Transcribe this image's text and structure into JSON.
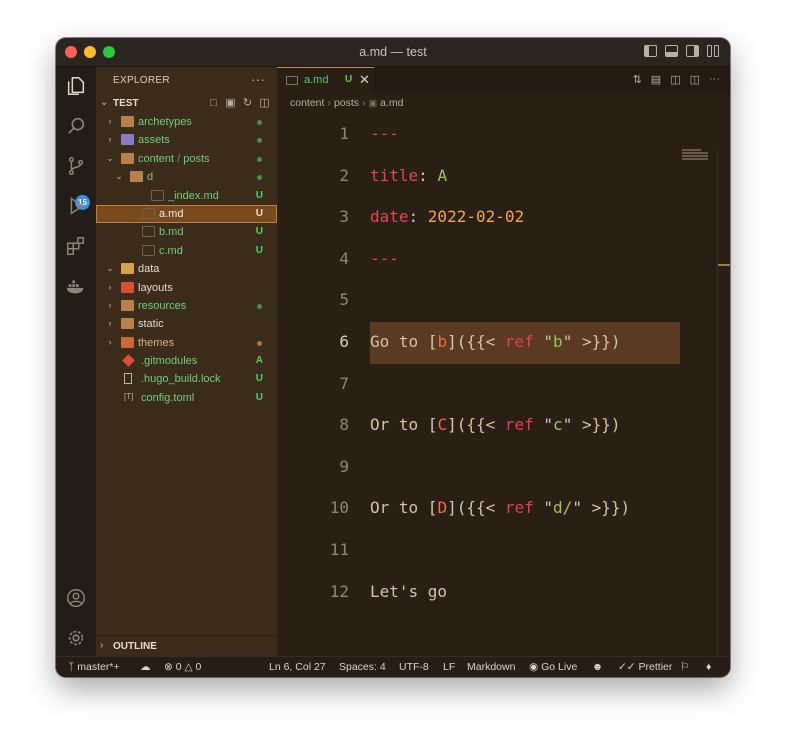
{
  "window": {
    "title": "a.md — test"
  },
  "activity": {
    "scm_badge": "15"
  },
  "sidebar": {
    "header": "EXPLORER",
    "more": "···",
    "folder": "TEST",
    "outline": "OUTLINE",
    "items": [
      {
        "label": "archetypes",
        "status": "",
        "color": "#6fcf7c",
        "type": "folder",
        "open": false,
        "indent": 0,
        "dot": "#4e8a52"
      },
      {
        "label": "assets",
        "status": "",
        "color": "#6fcf7c",
        "type": "folder-assets",
        "open": false,
        "indent": 0,
        "dot": "#4e8a52"
      },
      {
        "label": "content",
        "label2": "posts",
        "status": "",
        "color": "#6fcf7c",
        "type": "folder",
        "open": true,
        "indent": 0,
        "dot": "#4e8a52"
      },
      {
        "label": "d",
        "status": "",
        "color": "#6fcf7c",
        "type": "folder",
        "open": true,
        "indent": 1,
        "dot": "#4e8a52"
      },
      {
        "label": "_index.md",
        "status": "U",
        "color": "#6fcf7c",
        "type": "md",
        "indent": 3
      },
      {
        "label": "a.md",
        "status": "U",
        "color": "#f1ece4",
        "type": "md",
        "indent": 2,
        "selected": true
      },
      {
        "label": "b.md",
        "status": "U",
        "color": "#6fcf7c",
        "type": "md",
        "indent": 2
      },
      {
        "label": "c.md",
        "status": "U",
        "color": "#6fcf7c",
        "type": "md",
        "indent": 2
      },
      {
        "label": "data",
        "status": "",
        "color": "#e3dbcf",
        "type": "folder-data",
        "open": true,
        "indent": 0
      },
      {
        "label": "layouts",
        "status": "",
        "color": "#e3dbcf",
        "type": "folder-layouts",
        "open": false,
        "indent": 0
      },
      {
        "label": "resources",
        "status": "",
        "color": "#6fcf7c",
        "type": "folder",
        "open": false,
        "indent": 0,
        "dot": "#4e8a52"
      },
      {
        "label": "static",
        "status": "",
        "color": "#e3dbcf",
        "type": "folder",
        "open": false,
        "indent": 0
      },
      {
        "label": "themes",
        "status": "",
        "color": "#d6b67a",
        "type": "folder-themes",
        "open": false,
        "indent": 0,
        "dot": "#9a7d4d"
      },
      {
        "label": ".gitmodules",
        "status": "A",
        "color": "#6fcf7c",
        "type": "git",
        "indent": 0
      },
      {
        "label": ".hugo_build.lock",
        "status": "U",
        "color": "#6fcf7c",
        "type": "file",
        "indent": 0
      },
      {
        "label": "config.toml",
        "status": "U",
        "color": "#6fcf7c",
        "type": "toml",
        "indent": 0
      }
    ]
  },
  "editor": {
    "tab": {
      "name": "a.md",
      "status": "U",
      "close": "✕"
    },
    "breadcrumb": [
      "content",
      "posts",
      "a.md"
    ],
    "lines": [
      {
        "n": "1",
        "parts": [
          [
            "---",
            "c-dash"
          ]
        ]
      },
      {
        "n": "2",
        "parts": [
          [
            "title",
            "c-key"
          ],
          [
            ": ",
            "c-punc"
          ],
          [
            "A",
            "c-a"
          ]
        ]
      },
      {
        "n": "3",
        "parts": [
          [
            "date",
            "c-key"
          ],
          [
            ": ",
            "c-punc"
          ],
          [
            "2022-02-02",
            "c-date"
          ]
        ]
      },
      {
        "n": "4",
        "parts": [
          [
            "---",
            "c-dash"
          ]
        ]
      },
      {
        "n": "5",
        "parts": []
      },
      {
        "n": "6",
        "current": true,
        "parts": [
          [
            "Go to ",
            "c-text"
          ],
          [
            "[",
            "c-punc"
          ],
          [
            "b",
            "c-link"
          ],
          [
            "](",
            "c-punc"
          ],
          [
            "{{< ",
            "c-text"
          ],
          [
            "ref",
            "c-ref"
          ],
          [
            " \"",
            "c-text"
          ],
          [
            "b",
            "c-str"
          ],
          [
            "\" >}})",
            "c-text"
          ]
        ]
      },
      {
        "n": "7",
        "parts": []
      },
      {
        "n": "8",
        "parts": [
          [
            "Or to ",
            "c-text"
          ],
          [
            "[",
            "c-punc"
          ],
          [
            "C",
            "c-link"
          ],
          [
            "](",
            "c-punc"
          ],
          [
            "{{< ",
            "c-text"
          ],
          [
            "ref",
            "c-ref"
          ],
          [
            " \"",
            "c-text"
          ],
          [
            "c",
            "c-str"
          ],
          [
            "\" >}})",
            "c-text"
          ]
        ]
      },
      {
        "n": "9",
        "parts": []
      },
      {
        "n": "10",
        "parts": [
          [
            "Or to ",
            "c-text"
          ],
          [
            "[",
            "c-punc"
          ],
          [
            "D",
            "c-link"
          ],
          [
            "](",
            "c-punc"
          ],
          [
            "{{< ",
            "c-text"
          ],
          [
            "ref",
            "c-ref"
          ],
          [
            " \"",
            "c-text"
          ],
          [
            "d/",
            "c-str"
          ],
          [
            "\" >}})",
            "c-text"
          ]
        ]
      },
      {
        "n": "11",
        "parts": []
      },
      {
        "n": "12",
        "parts": [
          [
            "Let's go",
            "c-text"
          ]
        ]
      }
    ]
  },
  "status": {
    "branch": "master*+",
    "errors": "0",
    "warnings": "0",
    "position": "Ln 6, Col 27",
    "spaces": "Spaces: 4",
    "encoding": "UTF-8",
    "eol": "LF",
    "language": "Markdown",
    "golive": "Go Live",
    "prettier": "Prettier"
  }
}
